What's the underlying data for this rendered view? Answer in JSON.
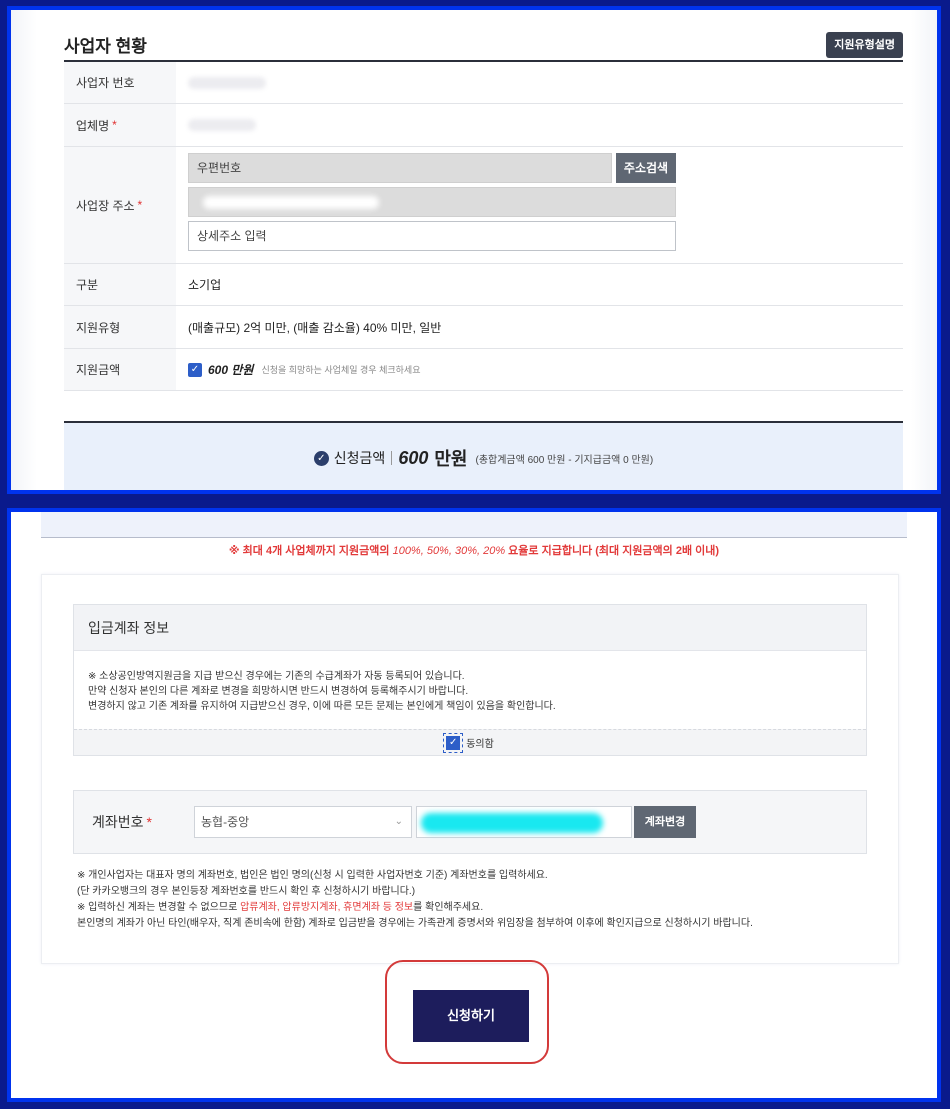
{
  "business_status": {
    "title": "사업자 현황",
    "guide_button": "지원유형설명",
    "rows": {
      "biz_no_label": "사업자 번호",
      "company_label": "업체명",
      "address_label": "사업장 주소",
      "category_label": "구분",
      "category_value": "소기업",
      "support_type_label": "지원유형",
      "support_type_value": "(매출규모) 2억 미만, (매출 감소율) 40% 미만,  일반",
      "support_amount_label": "지원금액",
      "support_amount_value": "600 만원",
      "support_amount_note": "신청을 희망하는 사업체일 경우 체크하세요"
    },
    "required_mark": "*",
    "address": {
      "zip_placeholder": "우편번호",
      "search_button": "주소검색",
      "detail_placeholder": "상세주소 입력"
    }
  },
  "summary": {
    "label": "신청금액",
    "amount": "600",
    "unit": "만원",
    "detail": "(총합계금액 600 만원 - 기지급금액 0 만원)"
  },
  "notice_red": {
    "prefix": "※ 최대 4개 사업체까지 지원금액의 ",
    "pct": "100%, 50%, 30%, 20%",
    "suffix": " 요율로 지급합니다 (최대 지원금액의 2배 이내)"
  },
  "account_info": {
    "title": "입금계좌 정보",
    "lines": [
      "※ 소상공인방역지원금을 지급 받으신 경우에는 기존의 수급계좌가 자동 등록되어 있습니다.",
      "만약 신청자 본인의 다른 계좌로 변경을 희망하시면 반드시 변경하여 등록해주시기 바랍니다.",
      "변경하지 않고 기존 계좌를 유지하여 지급받으신 경우, 이에 따른 모든 문제는 본인에게 책임이 있음을 확인합니다."
    ],
    "agree_label": "동의함"
  },
  "account_number": {
    "label": "계좌번호",
    "bank": "농협-중앙",
    "change_button": "계좌변경"
  },
  "notes": {
    "line1": "※ 개인사업자는 대표자 명의 계좌번호, 법인은 법인 명의(신청 시 입력한 사업자번호 기준) 계좌번호를 입력하세요.",
    "line2": "(단 카카오뱅크의 경우 본인등장 계좌번호를 반드시 확인 후 신청하시기 바랍니다.)",
    "line3_prefix": "※ 입력하신 계좌는 변경할 수 없으므로 ",
    "line3_red": "압류계좌, 압류방지계좌, 휴면계좌 등 정보",
    "line3_suffix": "를 확인해주세요.",
    "line4": "본인명의 계좌가 아닌 타인(배우자, 직계 존비속에 한함) 계좌로 입금받을 경우에는 가족관계 증명서와 위임장을 첨부하여 이후에 확인지급으로 신청하시기 바랍니다."
  },
  "apply_button": "신청하기"
}
